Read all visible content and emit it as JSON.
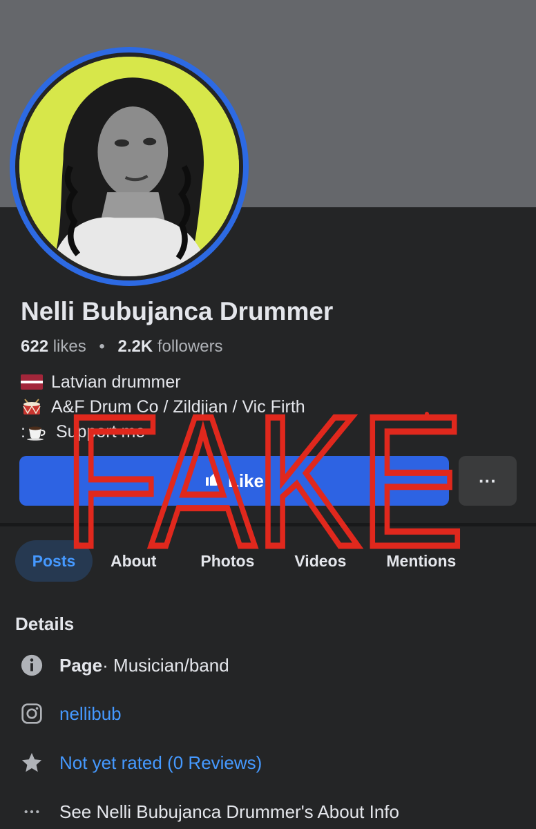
{
  "profile": {
    "name": "Nelli Bubujanca Drummer",
    "likes_count": "622",
    "likes_label": "likes",
    "separator": "•",
    "followers_count": "2.2K",
    "followers_label": "followers"
  },
  "bio": [
    {
      "icon": "latvia-flag-icon",
      "text": "Latvian drummer"
    },
    {
      "icon": "drum-icon",
      "text": "A&F Drum Co / Zildjian / Vic Firth"
    },
    {
      "icon": "coffee-icon",
      "prefix": ":",
      "text": "Support me"
    }
  ],
  "actions": {
    "like_label": "Like",
    "more_label": "···"
  },
  "tabs": [
    {
      "label": "Posts",
      "active": true
    },
    {
      "label": "About"
    },
    {
      "label": "Photos"
    },
    {
      "label": "Videos"
    },
    {
      "label": "Mentions"
    }
  ],
  "details": {
    "heading": "Details",
    "page_type_label": "Page",
    "page_type_value": " · Musician/band",
    "instagram": "nellibub",
    "rating": "Not yet rated (0 Reviews)",
    "about_link": "See Nelli Bubujanca Drummer's About Info"
  },
  "overlay": {
    "stamp_text": "FAKE",
    "stamp_color": "#e0281d"
  },
  "colors": {
    "accent_blue": "#2d63e3",
    "link_blue": "#4599ff",
    "background": "#242526",
    "cover": "#65676b"
  }
}
